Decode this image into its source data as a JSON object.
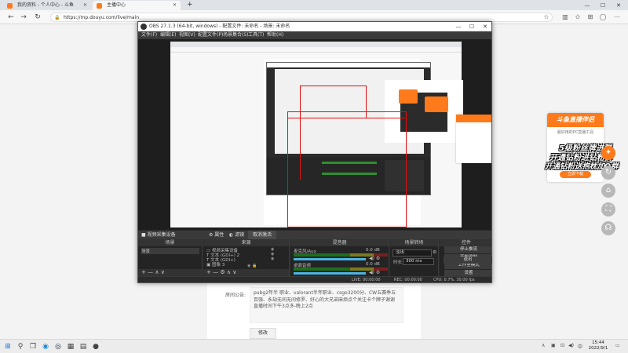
{
  "browser": {
    "tabs": [
      {
        "label": "我的资料 - 个人中心 - 斗鱼"
      },
      {
        "label": "主播中心"
      }
    ],
    "url": "https://mp.douyu.com/live/main",
    "new_tab_symbol": "+"
  },
  "page": {
    "announcement_label": "房间公告:",
    "announcement_text": "pubg2年半 职业、valorant半年职业、csgo3200分、CW五赛季五百强、永劫无间无间修罗、好心的大兄弟麻烦点个关注卡个牌子谢谢 直播时间下午3点多-晚上2点",
    "modify_button": "修改"
  },
  "promo": {
    "title": "斗鱼直播伴侣",
    "subtitle": "最好用的PC直播工具",
    "line1": "5级粉丝牌进群",
    "line2": "开通钻粉进钻粉群",
    "line3": "开通钻粉送抱枕加Q群",
    "button": "立即下载"
  },
  "obs": {
    "title": "OBS 27.1.3 (64-bit, windows) - 配置文件: 未命名 - 场景: 未命名",
    "menu": [
      "文件(F)",
      "编辑(E)",
      "视图(V)",
      "配置文件(P)",
      "场景集合(S)",
      "工具(T)",
      "帮助(H)"
    ],
    "tabs": {
      "source_props": "视频采集设备",
      "props": "属性",
      "filters": "滤镜",
      "deactivate": "取消激活"
    },
    "docks": {
      "scenes": {
        "title": "场景",
        "items": [
          "场景"
        ]
      },
      "sources": {
        "title": "来源",
        "items": [
          "视频采集设备",
          "文本 (GDI+) 2",
          "文本 (GDI+)",
          "图像 3",
          "图像 2",
          "图像"
        ]
      },
      "mixer": {
        "title": "混音器",
        "channels": [
          {
            "name": "麦克风/Aux",
            "db": "0.0 dB"
          },
          {
            "name": "桌面音频",
            "db": "0.0 dB"
          }
        ]
      },
      "transitions": {
        "title": "场景转场",
        "type": "淡出",
        "duration_label": "时长",
        "duration": "300 ms"
      },
      "controls": {
        "title": "控件",
        "buttons": [
          "停止推流",
          "开始录制",
          "工作室模式",
          "设置",
          "退出"
        ]
      }
    },
    "status": {
      "live": "LIVE: 00:00:00",
      "rec": "REC: 00:00:00",
      "cpu": "CPU: 0.7%, 30.00 fps"
    }
  },
  "taskbar": {
    "time": "15:44",
    "date": "2022/9/1"
  },
  "colors": {
    "accent_orange": "#ff7a1a",
    "red_outline": "#e01010",
    "obs_dark": "#2b2b2b"
  }
}
